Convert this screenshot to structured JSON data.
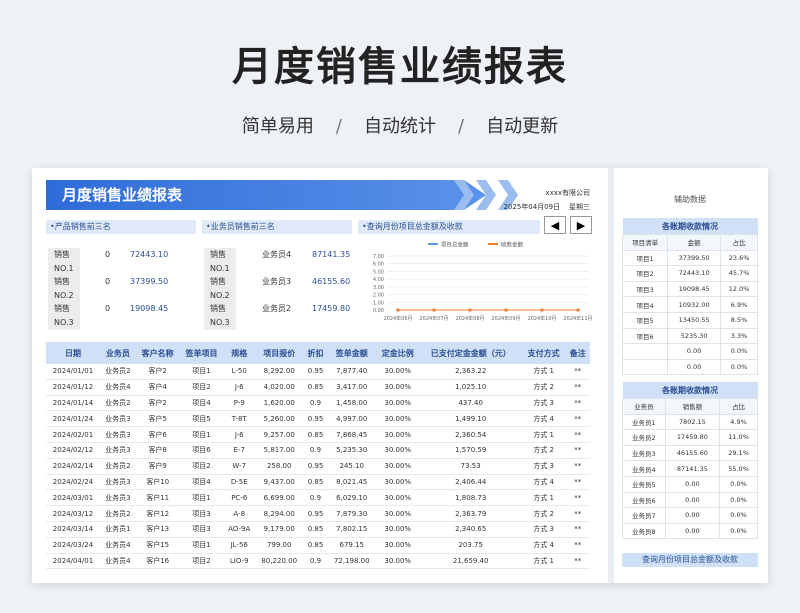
{
  "hero": {
    "title": "月度销售业绩报表",
    "tags": [
      "简单易用",
      "自动统计",
      "自动更新"
    ],
    "sep": "/"
  },
  "sheet": {
    "banner_title": "月度销售业绩报表",
    "company": "xxxx有限公司",
    "date": "2025年04月09日",
    "weekday": "星期三",
    "sections": {
      "product_top3": "•产品销售前三名",
      "rep_top3": "•业务员销售前三名",
      "query": "•查询月份项目总金额及收款"
    },
    "nav": {
      "prev": "◀",
      "next": "▶"
    },
    "product_ranks": [
      {
        "rank": "销售NO.1",
        "name": "0",
        "value": "72443.10"
      },
      {
        "rank": "销售NO.2",
        "name": "0",
        "value": "37399.50"
      },
      {
        "rank": "销售NO.3",
        "name": "0",
        "value": "19098.45"
      }
    ],
    "rep_ranks": [
      {
        "rank": "销售NO.1",
        "name": "业务员4",
        "value": "87141.35"
      },
      {
        "rank": "销售NO.2",
        "name": "业务员3",
        "value": "46155.60"
      },
      {
        "rank": "销售NO.3",
        "name": "业务员2",
        "value": "17459.80"
      }
    ],
    "table": {
      "headers": [
        "日期",
        "业务员",
        "客户名称",
        "签单项目",
        "规格",
        "项目报价",
        "折扣",
        "签单金额",
        "定金比例",
        "已支付定金金额（元）",
        "支付方式",
        "备注"
      ],
      "rows": [
        [
          "2024/01/01",
          "业务员2",
          "客户2",
          "项目1",
          "L-50",
          "8,292.00",
          "0.95",
          "7,877.40",
          "30.00%",
          "2,363.22",
          "方式 1",
          "**"
        ],
        [
          "2024/01/12",
          "业务员4",
          "客户4",
          "项目2",
          "J-6",
          "4,020.00",
          "0.85",
          "3,417.00",
          "30.00%",
          "1,025.10",
          "方式 2",
          "**"
        ],
        [
          "2024/01/14",
          "业务员2",
          "客户2",
          "项目4",
          "P-9",
          "1,620.00",
          "0.9",
          "1,458.00",
          "30.00%",
          "437.40",
          "方式 3",
          "**"
        ],
        [
          "2024/01/24",
          "业务员3",
          "客户5",
          "项目5",
          "T-8T",
          "5,260.00",
          "0.95",
          "4,997.00",
          "30.00%",
          "1,499.10",
          "方式 4",
          "**"
        ],
        [
          "2024/02/01",
          "业务员3",
          "客户6",
          "项目1",
          "J-6",
          "9,257.00",
          "0.85",
          "7,868.45",
          "30.00%",
          "2,360.54",
          "方式 1",
          "**"
        ],
        [
          "2024/02/12",
          "业务员3",
          "客户8",
          "项目6",
          "E-7",
          "5,817.00",
          "0.9",
          "5,235.30",
          "30.00%",
          "1,570.59",
          "方式 2",
          "**"
        ],
        [
          "2024/02/14",
          "业务员2",
          "客户9",
          "项目2",
          "W-7",
          "258.00",
          "0.95",
          "245.10",
          "30.00%",
          "73.53",
          "方式 3",
          "**"
        ],
        [
          "2024/02/24",
          "业务员3",
          "客户10",
          "项目4",
          "D-5E",
          "9,437.00",
          "0.85",
          "8,021.45",
          "30.00%",
          "2,406.44",
          "方式 4",
          "**"
        ],
        [
          "2024/03/01",
          "业务员3",
          "客户11",
          "项目1",
          "PC-6",
          "6,699.00",
          "0.9",
          "6,029.10",
          "30.00%",
          "1,808.73",
          "方式 1",
          "**"
        ],
        [
          "2024/03/12",
          "业务员2",
          "客户12",
          "项目3",
          "A-8",
          "8,294.00",
          "0.95",
          "7,879.30",
          "30.00%",
          "2,363.79",
          "方式 2",
          "**"
        ],
        [
          "2024/03/14",
          "业务员1",
          "客户13",
          "项目3",
          "AO-9A",
          "9,179.00",
          "0.85",
          "7,802.15",
          "30.00%",
          "2,340.65",
          "方式 3",
          "**"
        ],
        [
          "2024/03/24",
          "业务员4",
          "客户15",
          "项目1",
          "JL-56",
          "799.00",
          "0.85",
          "679.15",
          "30.00%",
          "203.75",
          "方式 4",
          "**"
        ],
        [
          "2024/04/01",
          "业务员4",
          "客户16",
          "项目2",
          "LIO-9",
          "80,220.00",
          "0.9",
          "72,198.00",
          "30.00%",
          "21,659.40",
          "方式 1",
          "**"
        ]
      ]
    }
  },
  "chart_data": {
    "type": "line",
    "categories": [
      "2024年06月",
      "2024年07月",
      "2024年08月",
      "2024年09月",
      "2024年10月",
      "2024年11月"
    ],
    "series": [
      {
        "name": "项目总金额",
        "values": [
          0,
          0,
          0,
          0,
          0,
          0
        ],
        "color": "#5b9bd5"
      },
      {
        "name": "收款金额",
        "values": [
          0,
          0,
          0,
          0,
          0,
          0
        ],
        "color": "#ed7d31"
      }
    ],
    "y_ticks": [
      "7.00",
      "6.00",
      "5.00",
      "4.00",
      "3.00",
      "2.00",
      "1.00",
      "0.00"
    ],
    "ylim": [
      0,
      7
    ]
  },
  "sidebar": {
    "title": "辅助数据",
    "project_table": {
      "caption": "各账期收款情况",
      "headers": [
        "项目清单",
        "金额",
        "占比"
      ],
      "rows": [
        [
          "项目1",
          "37399.50",
          "23.6%"
        ],
        [
          "项目2",
          "72443.10",
          "45.7%"
        ],
        [
          "项目3",
          "19098.45",
          "12.0%"
        ],
        [
          "项目4",
          "10932.00",
          "6.9%"
        ],
        [
          "项目5",
          "13450.55",
          "8.5%"
        ],
        [
          "项目6",
          "5235.30",
          "3.3%"
        ],
        [
          "",
          "0.00",
          "0.0%"
        ],
        [
          "",
          "0.00",
          "0.0%"
        ]
      ]
    },
    "rep_table": {
      "caption": "各账期收款情况",
      "headers": [
        "业务员",
        "销售额",
        "占比"
      ],
      "rows": [
        [
          "业务员1",
          "7802.15",
          "4.9%"
        ],
        [
          "业务员2",
          "17459.80",
          "11.0%"
        ],
        [
          "业务员3",
          "46155.60",
          "29.1%"
        ],
        [
          "业务员4",
          "87141.35",
          "55.0%"
        ],
        [
          "业务员5",
          "0.00",
          "0.0%"
        ],
        [
          "业务员6",
          "0.00",
          "0.0%"
        ],
        [
          "业务员7",
          "0.00",
          "0.0%"
        ],
        [
          "业务员8",
          "0.00",
          "0.0%"
        ]
      ]
    },
    "bottom_caption": "查询月份项目总金额及收款"
  }
}
